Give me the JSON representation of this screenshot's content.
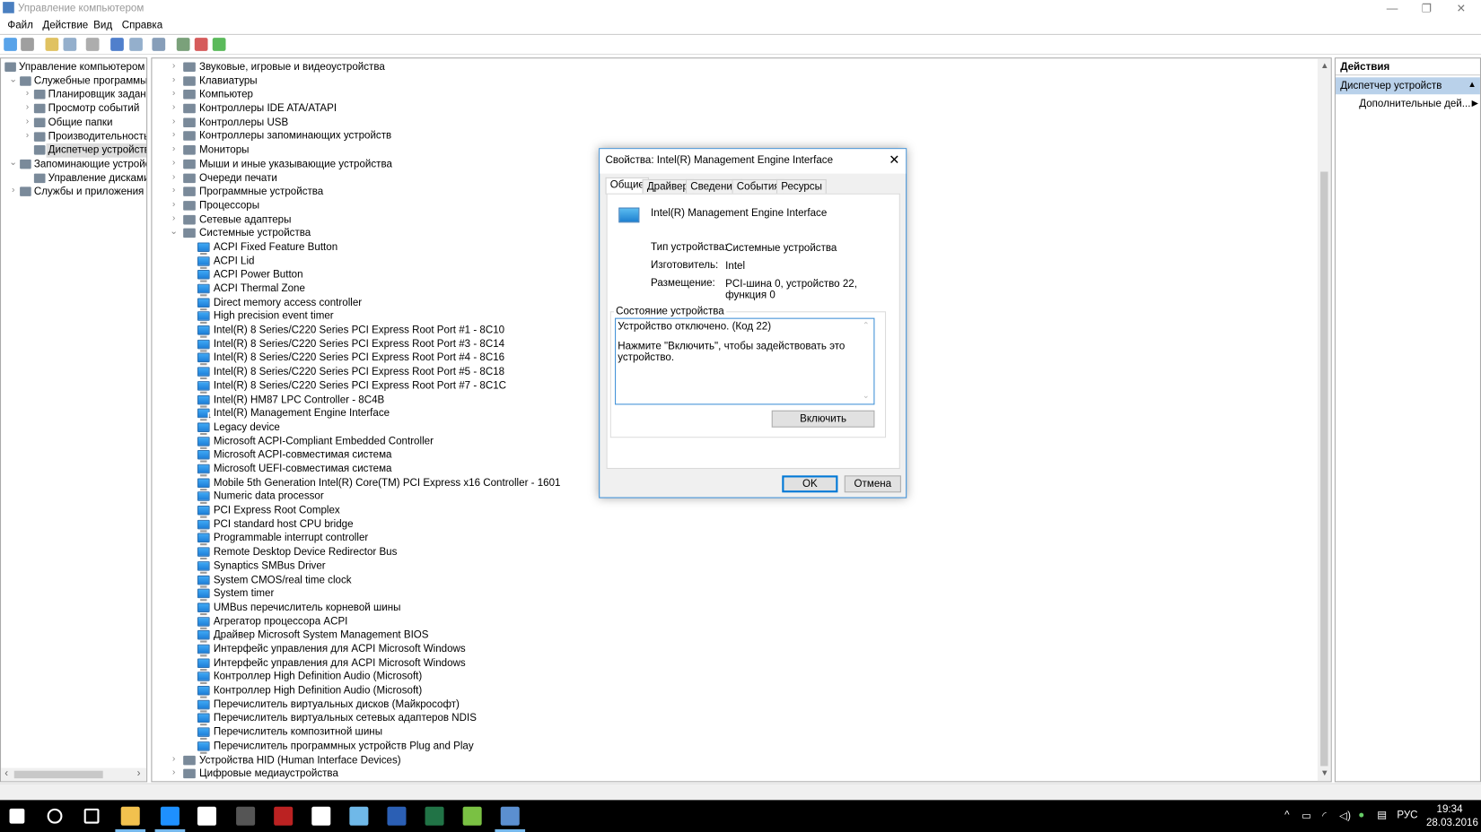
{
  "window": {
    "title": "Управление компьютером",
    "minimize": "—",
    "restore": "❐",
    "close": "✕"
  },
  "menu": [
    "Файл",
    "Действие",
    "Вид",
    "Справка"
  ],
  "toolbar_icons": [
    "back-icon",
    "forward-icon",
    "up-folder-icon",
    "show-hide-tree-icon",
    "properties-icon",
    "help-icon",
    "action-pane-icon",
    "scan-hardware-icon",
    "update-driver-icon",
    "disable-device-icon",
    "enable-device-icon"
  ],
  "left_tree": [
    {
      "label": "Управление компьютером (л",
      "level": 0,
      "chev": "",
      "sel": false
    },
    {
      "label": "Служебные программы",
      "level": 1,
      "chev": "v",
      "sel": false
    },
    {
      "label": "Планировщик заданий",
      "level": 2,
      "chev": ">",
      "sel": false
    },
    {
      "label": "Просмотр событий",
      "level": 2,
      "chev": ">",
      "sel": false
    },
    {
      "label": "Общие папки",
      "level": 2,
      "chev": ">",
      "sel": false
    },
    {
      "label": "Производительность",
      "level": 2,
      "chev": ">",
      "sel": false
    },
    {
      "label": "Диспетчер устройств",
      "level": 2,
      "chev": "",
      "sel": true
    },
    {
      "label": "Запоминающие устройст",
      "level": 1,
      "chev": "v",
      "sel": false
    },
    {
      "label": "Управление дисками",
      "level": 2,
      "chev": "",
      "sel": false
    },
    {
      "label": "Службы и приложения",
      "level": 1,
      "chev": ">",
      "sel": false
    }
  ],
  "device_tree": {
    "categories_before": [
      "Звуковые, игровые и видеоустройства",
      "Клавиатуры",
      "Компьютер",
      "Контроллеры IDE ATA/ATAPI",
      "Контроллеры USB",
      "Контроллеры запоминающих устройств",
      "Мониторы",
      "Мыши и иные указывающие устройства",
      "Очереди печати",
      "Программные устройства",
      "Процессоры",
      "Сетевые адаптеры"
    ],
    "expanded": "Системные устройства",
    "devices": [
      "ACPI Fixed Feature Button",
      "ACPI Lid",
      "ACPI Power Button",
      "ACPI Thermal Zone",
      "Direct memory access controller",
      "High precision event timer",
      "Intel(R) 8 Series/C220 Series PCI Express Root Port #1 - 8C10",
      "Intel(R) 8 Series/C220 Series PCI Express Root Port #3 - 8C14",
      "Intel(R) 8 Series/C220 Series PCI Express Root Port #4 - 8C16",
      "Intel(R) 8 Series/C220 Series PCI Express Root Port #5 - 8C18",
      "Intel(R) 8 Series/C220 Series PCI Express Root Port #7 - 8C1C",
      "Intel(R) HM87 LPC Controller - 8C4B",
      "Intel(R) Management Engine Interface",
      "Legacy device",
      "Microsoft ACPI-Compliant Embedded Controller",
      "Microsoft ACPI-совместимая система",
      "Microsoft UEFI-совместимая система",
      "Mobile 5th Generation Intel(R) Core(TM) PCI Express x16 Controller - 1601",
      "Numeric data processor",
      "PCI Express Root Complex",
      "PCI standard host CPU bridge",
      "Programmable interrupt controller",
      "Remote Desktop Device Redirector Bus",
      "Synaptics SMBus Driver",
      "System CMOS/real time clock",
      "System timer",
      "UMBus перечислитель корневой шины",
      "Агрегатор процессора ACPI",
      "Драйвер Microsoft System Management BIOS",
      "Интерфейс управления для ACPI Microsoft Windows",
      "Интерфейс управления для ACPI Microsoft Windows",
      "Контроллер High Definition Audio (Microsoft)",
      "Контроллер High Definition Audio (Microsoft)",
      "Перечислитель виртуальных дисков (Майкрософт)",
      "Перечислитель виртуальных сетевых адаптеров NDIS",
      "Перечислитель композитной шины",
      "Перечислитель программных устройств Plug and Play"
    ],
    "disabled_device": "Intel(R) Management Engine Interface",
    "categories_after": [
      "Устройства HID (Human Interface Devices)",
      "Цифровые медиаустройства"
    ]
  },
  "actions": {
    "header": "Действия",
    "section": "Диспетчер устройств",
    "item": "Дополнительные дей..."
  },
  "dialog": {
    "title": "Свойства: Intel(R) Management Engine Interface",
    "tabs": [
      "Общие",
      "Драйвер",
      "Сведения",
      "События",
      "Ресурсы"
    ],
    "device_name": "Intel(R) Management Engine Interface",
    "type_label": "Тип устройства:",
    "type_value": "Системные устройства",
    "mfr_label": "Изготовитель:",
    "mfr_value": "Intel",
    "loc_label": "Размещение:",
    "loc_value": "PCI-шина 0, устройство 22, функция 0",
    "status_group": "Состояние устройства",
    "status_line1": "Устройство отключено. (Код 22)",
    "status_line2": "Нажмите \"Включить\", чтобы задействовать это устройство.",
    "enable_button": "Включить",
    "ok": "OK",
    "cancel": "Отмена"
  },
  "taskbar": {
    "apps": [
      "start-icon",
      "search-icon",
      "task-view-icon",
      "file-explorer-icon",
      "edge-icon",
      "store-icon",
      "app-icon",
      "game-icon",
      "calculator-icon",
      "notepad-icon",
      "word-icon",
      "excel-icon",
      "utorrent-icon",
      "computer-management-icon"
    ],
    "lang": "РУС",
    "time": "19:34",
    "date": "28.03.2016"
  }
}
